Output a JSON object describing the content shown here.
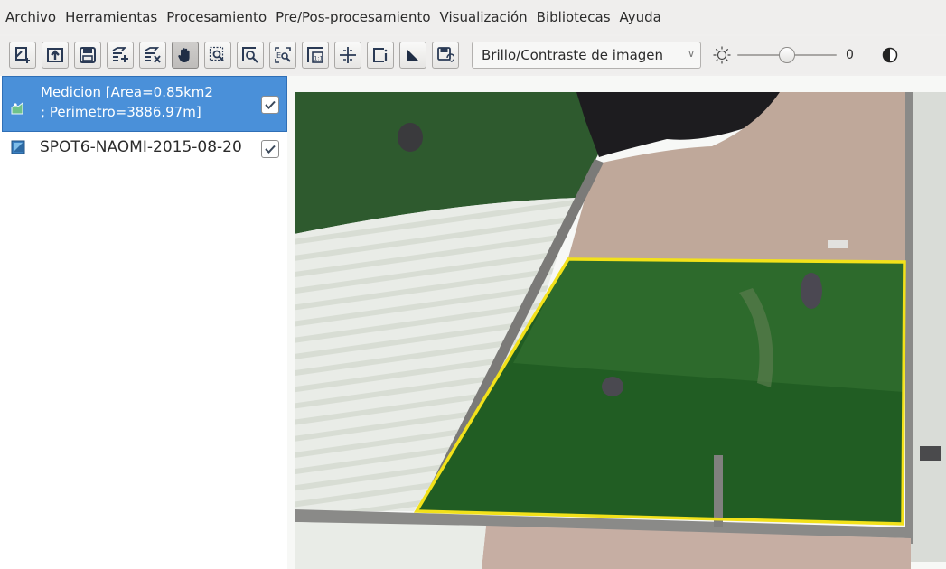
{
  "menu": [
    "Archivo",
    "Herramientas",
    "Procesamiento",
    "Pre/Pos-procesamiento",
    "Visualización",
    "Bibliotecas",
    "Ayuda"
  ],
  "toolbar": {
    "tools": [
      {
        "name": "new-layer-icon",
        "active": false
      },
      {
        "name": "open-icon",
        "active": false
      },
      {
        "name": "save-icon",
        "active": false
      },
      {
        "name": "add-band-icon",
        "active": false
      },
      {
        "name": "remove-band-icon",
        "active": false
      },
      {
        "name": "pan-hand-icon",
        "active": true
      },
      {
        "name": "zoom-region-icon",
        "active": false
      },
      {
        "name": "zoom-in-icon",
        "active": false
      },
      {
        "name": "zoom-extent-icon",
        "active": false
      },
      {
        "name": "zoom-1to1-icon",
        "active": false
      },
      {
        "name": "crosshair-icon",
        "active": false
      },
      {
        "name": "info-icon",
        "active": false
      },
      {
        "name": "measure-icon",
        "active": false
      },
      {
        "name": "save-view-icon",
        "active": false
      }
    ],
    "enhance_select": "Brillo/Contraste de imagen",
    "brightness_value": "0",
    "brightness_level": 0.5
  },
  "layers": {
    "selected_line1": "Medicion [Area=0.85km2",
    "selected_line2": "; Perimetro=3886.97m]",
    "selected_checked": true,
    "spot_label": "SPOT6-NAOMI-2015-08-20",
    "spot_checked": true
  },
  "colors": {
    "selection_blue": "#4a90d9",
    "measurement_outline": "#f2e11a",
    "field_green": "#1b5e1c"
  }
}
